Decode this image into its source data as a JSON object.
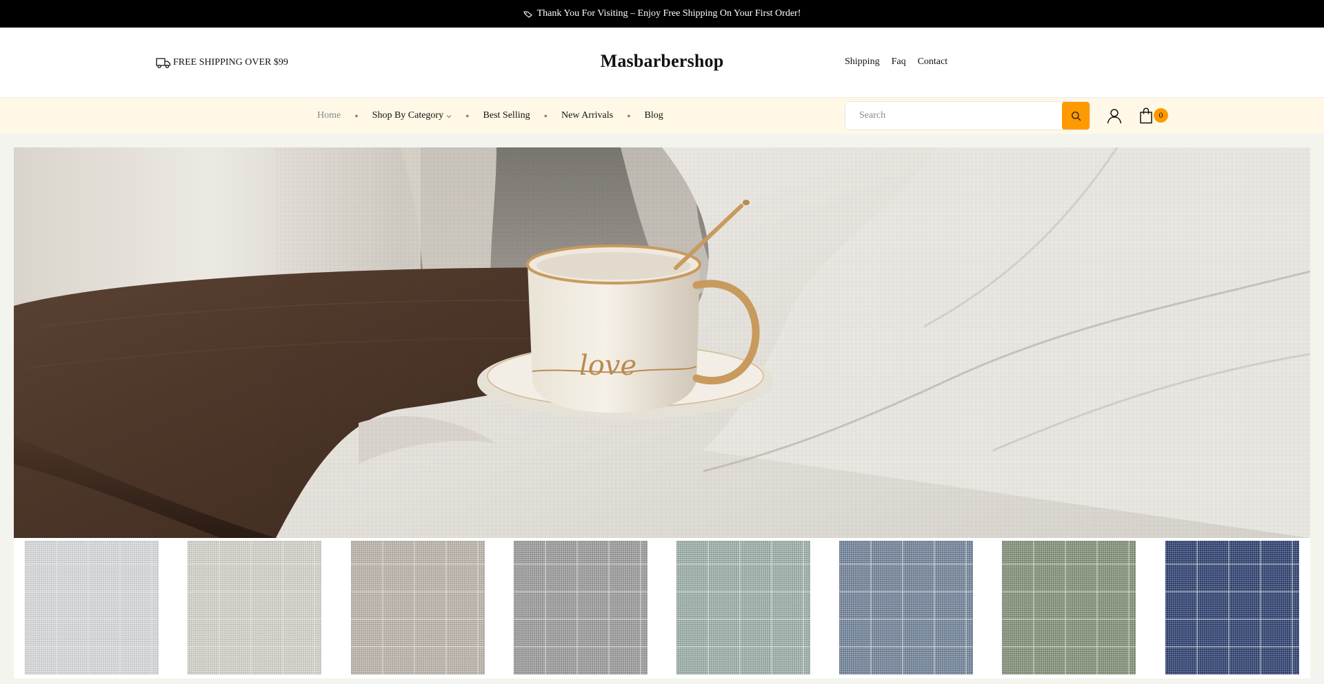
{
  "announcement": {
    "icon": "tag-icon",
    "text": "Thank You For Visiting – Enjoy Free Shipping On Your First Order!"
  },
  "header": {
    "shipping_icon": "truck-icon",
    "shipping_note": "FREE SHIPPING OVER $99",
    "logo": "Masbarbershop",
    "links": [
      "Shipping",
      "Faq",
      "Contact"
    ]
  },
  "nav": {
    "items": [
      "Home",
      "Shop By Category",
      "Best Selling",
      "New Arrivals",
      "Blog"
    ],
    "search_placeholder": "Search",
    "cart_count": "0",
    "colors": {
      "bar_bg": "#fff8e6",
      "accent": "#ff9900"
    }
  },
  "hero": {
    "image_name": "linen-curtain-with-coffee-cup",
    "cup_text": "love"
  },
  "swatches": {
    "colors": [
      "#e7e9ec",
      "#e3e2d8",
      "#c9c1b6",
      "#a7a7a7",
      "#a9bcb6",
      "#7c8ea6",
      "#8e9c81",
      "#34487a"
    ]
  }
}
